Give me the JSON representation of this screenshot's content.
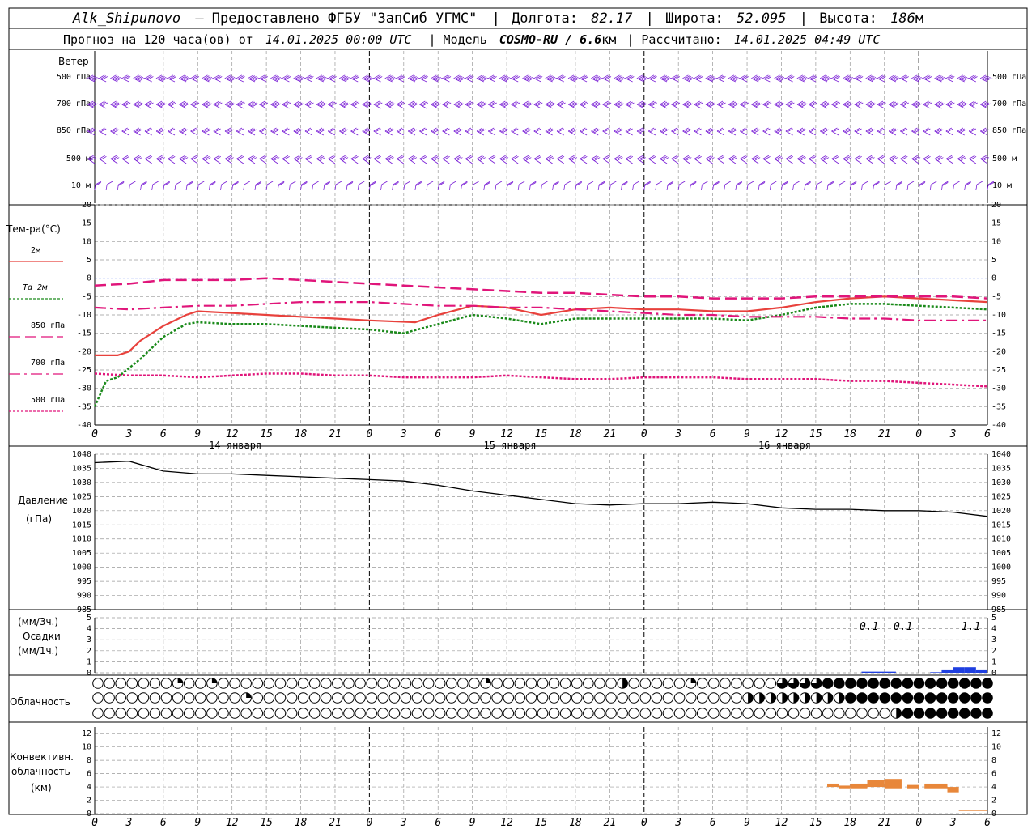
{
  "header": {
    "station": "Alk_Shipunovo",
    "provider": "– Предоставлено ФГБУ \"ЗапСиб УГМС\"",
    "lon_label": "Долгота:",
    "lon": "82.17",
    "lat_label": "Широта:",
    "lat": "52.095",
    "alt_label": "Высота:",
    "alt": "186",
    "alt_unit": "м",
    "forecast_label": "Прогноз на 120 часа(ов) от",
    "forecast_start": "14.01.2025 00:00 UTC",
    "model_label": "| Модель",
    "model": "COSMO-RU / 6.6",
    "model_unit": "км",
    "calc_label": "| Рассчитано:",
    "calc_time": "14.01.2025 04:49 UTC"
  },
  "wind_panel": {
    "title": "Ветер",
    "levels": [
      "500 гПа",
      "700 гПа",
      "850 гПа",
      "500 м",
      "10  м"
    ],
    "color": "#7a1fd6"
  },
  "temp_panel": {
    "title": "Тем-ра(°C)",
    "legend": [
      {
        "label": "2м",
        "color": "#e8413c",
        "style": "solid"
      },
      {
        "label": "Td  2м",
        "color": "#1a8a1a",
        "style": "dotted"
      },
      {
        "label": "850 гПа",
        "color": "#e0157a",
        "style": "dashed"
      },
      {
        "label": "700 гПа",
        "color": "#e0157a",
        "style": "dashdot"
      },
      {
        "label": "500 гПа",
        "color": "#e0157a",
        "style": "dotted"
      }
    ],
    "ylim": [
      -40,
      20
    ],
    "yticks": [
      20,
      15,
      10,
      5,
      0,
      -5,
      -10,
      -15,
      -20,
      -25,
      -30,
      -35,
      -40
    ]
  },
  "pressure_panel": {
    "title": "Давление",
    "unit": "(гПа)",
    "ylim": [
      985,
      1040
    ],
    "yticks": [
      1040,
      1035,
      1030,
      1025,
      1020,
      1015,
      1010,
      1005,
      1000,
      995,
      990,
      985
    ]
  },
  "precip_panel": {
    "unit3": "(мм/3ч.)",
    "title": "Осадки",
    "unit1": "(мм/1ч.)",
    "ylim": [
      0,
      5
    ],
    "yticks": [
      5,
      4,
      3,
      2,
      1,
      0
    ],
    "annotations": [
      "0.1",
      "0.1",
      "1.1"
    ],
    "color": "#1f3fe0"
  },
  "cloud_panel": {
    "title": "Облачность"
  },
  "conv_panel": {
    "title1": "Конвективн.",
    "title2": "облачность",
    "unit": "(км)",
    "ylim": [
      0,
      13
    ],
    "yticks": [
      12,
      10,
      8,
      6,
      4,
      2,
      0
    ],
    "color": "#e8873a"
  },
  "x_axis": {
    "hour_labels": [
      "0",
      "3",
      "6",
      "9",
      "12",
      "15",
      "18",
      "21",
      "0",
      "3",
      "6",
      "9",
      "12",
      "15",
      "18",
      "21",
      "0",
      "3",
      "6",
      "9",
      "12",
      "15",
      "18",
      "21",
      "0",
      "3",
      "6"
    ],
    "days": [
      "14 января",
      "15 января",
      "16 января"
    ]
  },
  "chart_data": [
    {
      "type": "line",
      "title": "Тем-ра(°C)",
      "x_unit": "hours since 14.01.2025 00:00 UTC",
      "ylim": [
        -40,
        20
      ],
      "series": [
        {
          "name": "2м",
          "x": [
            0,
            2,
            3,
            4,
            6,
            8,
            9,
            12,
            15,
            18,
            21,
            24,
            28,
            30,
            33,
            36,
            39,
            42,
            45,
            48,
            51,
            54,
            57,
            60,
            63,
            66,
            69,
            72,
            75,
            78
          ],
          "values": [
            -21,
            -21,
            -20,
            -17,
            -13,
            -10,
            -9,
            -9.5,
            -10,
            -10.5,
            -11,
            -11.5,
            -12,
            -10,
            -7.5,
            -8,
            -10,
            -8.5,
            -8,
            -8.5,
            -8.5,
            -9,
            -9,
            -8,
            -6.5,
            -5.5,
            -5,
            -5.5,
            -6,
            -6.5
          ]
        },
        {
          "name": "Td  2м",
          "x": [
            0,
            1,
            2,
            4,
            6,
            8,
            9,
            12,
            15,
            18,
            21,
            24,
            27,
            30,
            33,
            36,
            39,
            42,
            45,
            48,
            51,
            54,
            57,
            60,
            63,
            66,
            69,
            72,
            75,
            78
          ],
          "values": [
            -35,
            -28,
            -27,
            -22,
            -16,
            -12.5,
            -12,
            -12.5,
            -12.5,
            -13,
            -13.5,
            -14,
            -15,
            -12.5,
            -10,
            -11,
            -12.5,
            -11,
            -11,
            -11,
            -11,
            -11,
            -11.5,
            -10,
            -8,
            -7,
            -7,
            -7.5,
            -8,
            -8.5
          ]
        },
        {
          "name": "850 гПа",
          "x": [
            0,
            3,
            6,
            9,
            12,
            15,
            18,
            21,
            24,
            27,
            30,
            33,
            36,
            39,
            42,
            45,
            48,
            51,
            54,
            57,
            60,
            63,
            66,
            69,
            72,
            75,
            78
          ],
          "values": [
            -2,
            -1.5,
            -0.5,
            -0.5,
            -0.5,
            0,
            -0.5,
            -1,
            -1.5,
            -2,
            -2.5,
            -3,
            -3.5,
            -4,
            -4,
            -4.5,
            -5,
            -5,
            -5.5,
            -5.5,
            -5.5,
            -5,
            -5,
            -5,
            -5,
            -5,
            -5.5
          ]
        },
        {
          "name": "700 гПа",
          "x": [
            0,
            3,
            6,
            9,
            12,
            15,
            18,
            21,
            24,
            27,
            30,
            33,
            36,
            39,
            42,
            45,
            48,
            51,
            54,
            57,
            60,
            63,
            66,
            69,
            72,
            75,
            78
          ],
          "values": [
            -8,
            -8.5,
            -8,
            -7.5,
            -7.5,
            -7,
            -6.5,
            -6.5,
            -6.5,
            -7,
            -7.5,
            -7.5,
            -8,
            -8,
            -8.5,
            -9,
            -9.5,
            -10,
            -10,
            -10.5,
            -10.5,
            -10.5,
            -11,
            -11,
            -11.5,
            -11.5,
            -11.5
          ]
        },
        {
          "name": "500 гПа",
          "x": [
            0,
            3,
            6,
            9,
            12,
            15,
            18,
            21,
            24,
            27,
            30,
            33,
            36,
            39,
            42,
            45,
            48,
            51,
            54,
            57,
            60,
            63,
            66,
            69,
            72,
            75,
            78
          ],
          "values": [
            -26,
            -26.5,
            -26.5,
            -27,
            -26.5,
            -26,
            -26,
            -26.5,
            -26.5,
            -27,
            -27,
            -27,
            -26.5,
            -27,
            -27.5,
            -27.5,
            -27,
            -27,
            -27,
            -27.5,
            -27.5,
            -27.5,
            -28,
            -28,
            -28.5,
            -29,
            -29.5
          ]
        }
      ]
    },
    {
      "type": "line",
      "title": "Давление",
      "x_unit": "hours since 14.01.2025 00:00 UTC",
      "ylim": [
        985,
        1040
      ],
      "series": [
        {
          "name": "Давление",
          "x": [
            0,
            3,
            6,
            9,
            12,
            15,
            18,
            21,
            24,
            27,
            30,
            33,
            36,
            39,
            42,
            45,
            48,
            51,
            54,
            57,
            60,
            63,
            66,
            69,
            72,
            75,
            78
          ],
          "values": [
            1037,
            1037.5,
            1034,
            1033,
            1033,
            1032.5,
            1032,
            1031.5,
            1031,
            1030.5,
            1029,
            1027,
            1025.5,
            1024,
            1022.5,
            1022,
            1022.5,
            1022.5,
            1023,
            1022.5,
            1021,
            1020.5,
            1020.5,
            1020,
            1020,
            1019.5,
            1018
          ]
        }
      ]
    },
    {
      "type": "bar",
      "title": "Осадки",
      "x_unit": "hours since 14.01.2025 00:00 UTC",
      "ylim": [
        0,
        5
      ],
      "x": [
        68,
        69,
        70,
        71,
        72,
        73,
        74,
        75,
        76,
        77,
        78
      ],
      "values": [
        0.1,
        0.1,
        0.1,
        0,
        0,
        0,
        0.05,
        0.3,
        0.5,
        0.5,
        0.3
      ]
    },
    {
      "type": "bar",
      "title": "Конвективн. облачность",
      "x_unit": "hours since 14.01.2025 00:00 UTC",
      "ylim": [
        0,
        13
      ],
      "segments": [
        {
          "x0": 64,
          "x1": 65,
          "bottom": 4,
          "top": 4.5
        },
        {
          "x0": 65,
          "x1": 66,
          "bottom": 3.8,
          "top": 4.2
        },
        {
          "x0": 66,
          "x1": 67.5,
          "bottom": 3.8,
          "top": 4.5
        },
        {
          "x0": 67.5,
          "x1": 69,
          "bottom": 4,
          "top": 5
        },
        {
          "x0": 69,
          "x1": 70.5,
          "bottom": 3.8,
          "top": 5.2
        },
        {
          "x0": 71,
          "x1": 72,
          "bottom": 3.8,
          "top": 4.3
        },
        {
          "x0": 72.5,
          "x1": 74.5,
          "bottom": 3.8,
          "top": 4.5
        },
        {
          "x0": 74.5,
          "x1": 75.5,
          "bottom": 3.2,
          "top": 4
        },
        {
          "x0": 75.5,
          "x1": 78,
          "bottom": 0.4,
          "top": 0.6
        }
      ]
    }
  ]
}
